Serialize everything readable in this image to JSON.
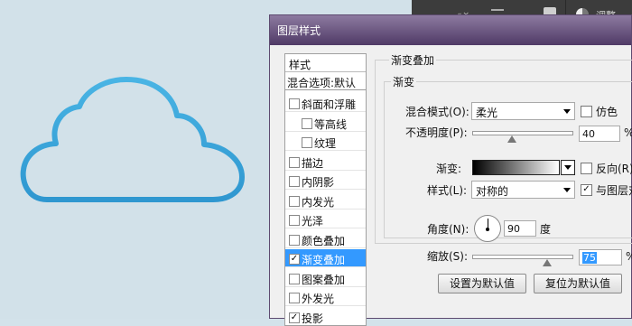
{
  "panel": {
    "collapse_glyph": "« ×",
    "adjust_label": "调整"
  },
  "dialog": {
    "title": "图层样式",
    "style_list": {
      "header": "样式",
      "blend_options": "混合选项:默认",
      "items": [
        {
          "label": "斜面和浮雕",
          "checked": false,
          "indent": false,
          "selected": false
        },
        {
          "label": "等高线",
          "checked": false,
          "indent": true,
          "selected": false
        },
        {
          "label": "纹理",
          "checked": false,
          "indent": true,
          "selected": false
        },
        {
          "label": "描边",
          "checked": false,
          "indent": false,
          "selected": false
        },
        {
          "label": "内阴影",
          "checked": false,
          "indent": false,
          "selected": false
        },
        {
          "label": "内发光",
          "checked": false,
          "indent": false,
          "selected": false
        },
        {
          "label": "光泽",
          "checked": false,
          "indent": false,
          "selected": false
        },
        {
          "label": "颜色叠加",
          "checked": false,
          "indent": false,
          "selected": false
        },
        {
          "label": "渐变叠加",
          "checked": true,
          "indent": false,
          "selected": true
        },
        {
          "label": "图案叠加",
          "checked": false,
          "indent": false,
          "selected": false
        },
        {
          "label": "外发光",
          "checked": false,
          "indent": false,
          "selected": false
        },
        {
          "label": "投影",
          "checked": true,
          "indent": false,
          "selected": false
        }
      ]
    },
    "section_title": "渐变叠加",
    "group_title": "渐变",
    "blend_mode": {
      "label": "混合模式(O):",
      "value": "柔光"
    },
    "dither": {
      "label": "仿色",
      "checked": false
    },
    "opacity": {
      "label": "不透明度(P):",
      "value": "40",
      "unit": "%",
      "level": 0.4
    },
    "gradient": {
      "label": "渐变:",
      "colors": [
        "#000000",
        "#ffffff"
      ]
    },
    "reverse": {
      "label": "反向(R)",
      "checked": false
    },
    "style": {
      "label": "样式(L):",
      "value": "对称的"
    },
    "align_layer": {
      "label": "与图层对",
      "checked": true
    },
    "angle": {
      "label": "角度(N):",
      "value": "90",
      "unit": "度"
    },
    "scale": {
      "label": "缩放(S):",
      "value": "75",
      "unit": "%",
      "level": 0.75
    },
    "buttons": {
      "set_default": "设置为默认值",
      "reset_default": "复位为默认值"
    }
  },
  "colors": {
    "canvas_bg": "#d2e1e9",
    "cloud_stroke": "#3aa3d8",
    "selection": "#3399ff",
    "titlebar": "#5d4a70"
  }
}
